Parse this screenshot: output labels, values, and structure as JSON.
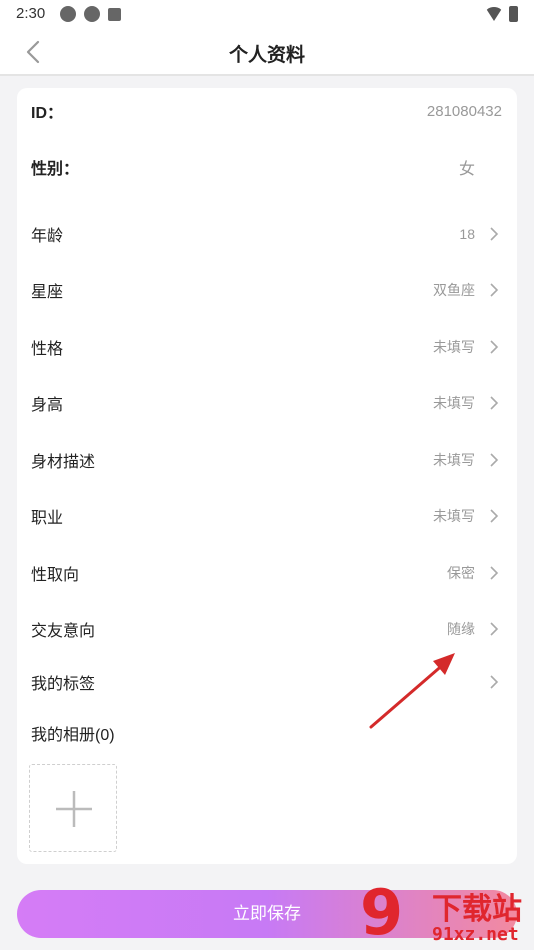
{
  "status_bar": {
    "time": "2:30"
  },
  "header": {
    "title": "个人资料"
  },
  "profile": {
    "id": {
      "label": "ID：",
      "value": "281080432"
    },
    "gender": {
      "label": "性别：",
      "value": "女"
    },
    "rows": [
      {
        "label": "年龄",
        "value": "18"
      },
      {
        "label": "星座",
        "value": "双鱼座"
      },
      {
        "label": "性格",
        "value": "未填写"
      },
      {
        "label": "身高",
        "value": "未填写"
      },
      {
        "label": "身材描述",
        "value": "未填写"
      },
      {
        "label": "职业",
        "value": "未填写"
      },
      {
        "label": "性取向",
        "value": "保密"
      },
      {
        "label": "交友意向",
        "value": "随缘"
      },
      {
        "label": "我的标签",
        "value": ""
      }
    ],
    "album_title": "我的相册(0)"
  },
  "save_button": {
    "label": "立即保存"
  },
  "watermark": {
    "brand": "下载站",
    "url": "91xz.net",
    "digit": "9"
  },
  "colors": {
    "accent_start": "#d57cf6",
    "accent_end": "#f28aa0",
    "annotation_arrow": "#d42a2a",
    "watermark": "#e0262e"
  },
  "icons": [
    "back-chevron-icon",
    "chevron-right-icon",
    "plus-icon",
    "wifi-icon",
    "battery-icon"
  ]
}
